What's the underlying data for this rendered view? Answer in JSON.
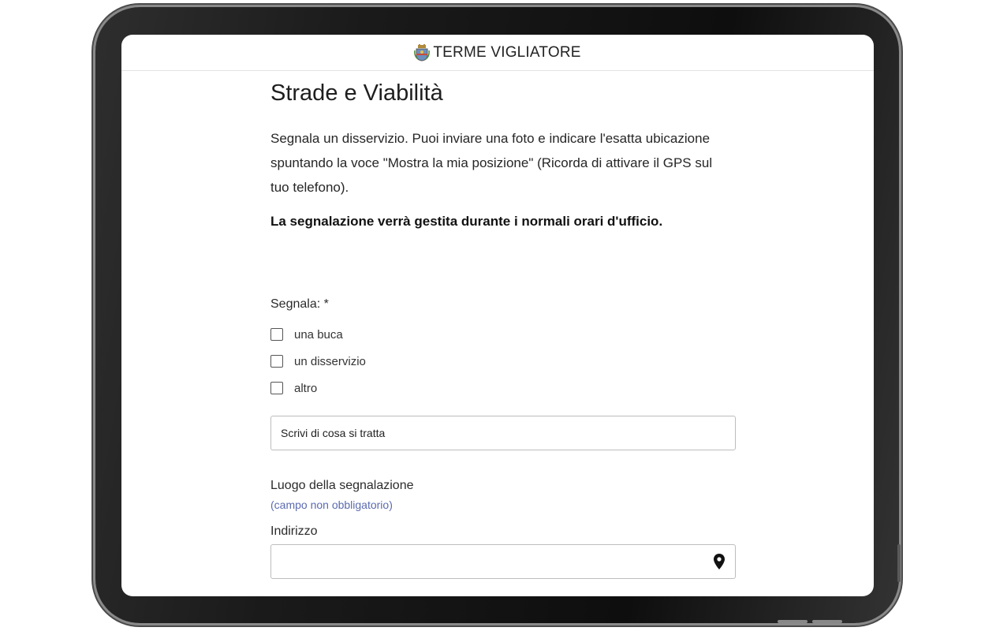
{
  "header": {
    "site_title": "TERME VIGLIATORE",
    "crest_icon": "coat-of-arms-icon"
  },
  "page": {
    "title": "Strade e Viabilità",
    "intro": "Segnala un disservizio. Puoi inviare una foto e indicare l'esatta ubicazione spuntando la voce \"Mostra la mia posizione\" (Ricorda di attivare il GPS sul tuo telefono).",
    "note": "La segnalazione verrà gestita durante i normali orari d'ufficio."
  },
  "form": {
    "segnala_label": "Segnala: *",
    "options": [
      {
        "label": "una buca",
        "checked": false
      },
      {
        "label": "un disservizio",
        "checked": false
      },
      {
        "label": "altro",
        "checked": false
      }
    ],
    "description_placeholder": "Scrivi di cosa si tratta",
    "location_label": "Luogo della segnalazione",
    "location_optional": "(campo non obbligatorio)",
    "address_label": "Indirizzo",
    "address_value": "",
    "address_icon": "map-pin-icon"
  },
  "colors": {
    "optional_text": "#5b6bb0",
    "device_frame": "#1a1a1a"
  }
}
